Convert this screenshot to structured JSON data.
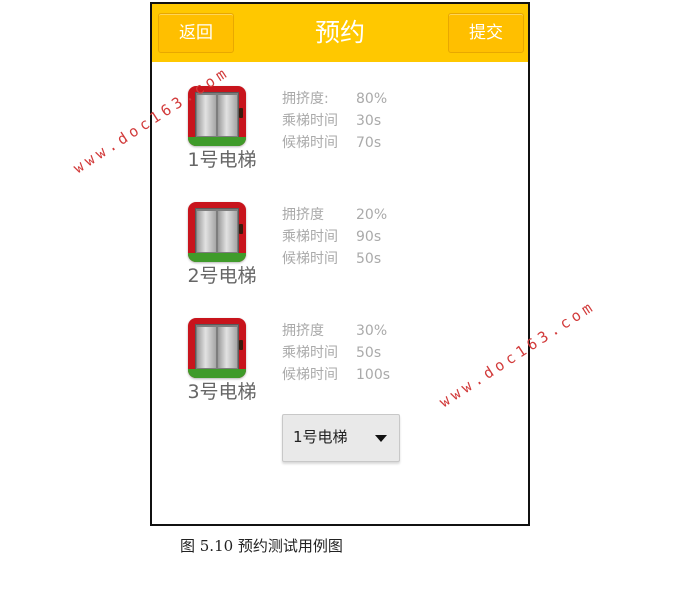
{
  "header": {
    "back_label": "返回",
    "title": "预约",
    "submit_label": "提交",
    "color": "#ffc800"
  },
  "elevators": [
    {
      "name": "1号电梯",
      "icon": "elevator-icon",
      "stats": [
        {
          "label": "拥挤度:",
          "value": "80%"
        },
        {
          "label": "乘梯时间",
          "value": "30s"
        },
        {
          "label": "候梯时间",
          "value": "70s"
        }
      ]
    },
    {
      "name": "2号电梯",
      "icon": "elevator-icon",
      "stats": [
        {
          "label": "拥挤度",
          "value": "20%"
        },
        {
          "label": "乘梯时间",
          "value": "90s"
        },
        {
          "label": "候梯时间",
          "value": "50s"
        }
      ]
    },
    {
      "name": "3号电梯",
      "icon": "elevator-icon",
      "stats": [
        {
          "label": "拥挤度",
          "value": "30%"
        },
        {
          "label": "乘梯时间",
          "value": "50s"
        },
        {
          "label": "候梯时间",
          "value": "100s"
        }
      ]
    }
  ],
  "elevator_select": {
    "selected": "1号电梯",
    "icon": "chevron-down-icon"
  },
  "caption": "图 5.10 预约测试用例图",
  "watermark": "www.doc163.com"
}
